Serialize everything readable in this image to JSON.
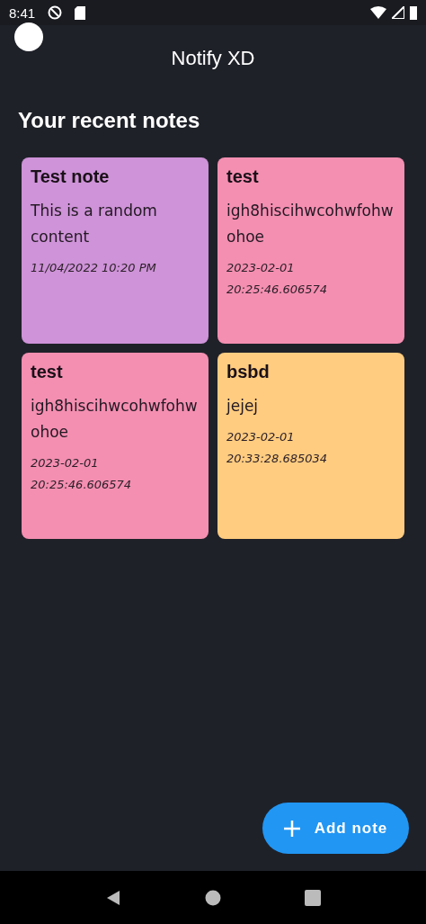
{
  "status_bar": {
    "time": "8:41"
  },
  "app_bar": {
    "title": "Notify XD"
  },
  "heading": "Your recent notes",
  "notes": [
    {
      "title": "Test note",
      "content": "This is a random content",
      "date": "11/04/2022 10:20 PM",
      "color": "#ce93d8"
    },
    {
      "title": "test",
      "content": "igh8hiscihwcohwfohwohoe",
      "date": "2023-02-01 20:25:46.606574",
      "color": "#f48fb1"
    },
    {
      "title": "test",
      "content": "igh8hiscihwcohwfohwohoe",
      "date": "2023-02-01 20:25:46.606574",
      "color": "#f48fb1"
    },
    {
      "title": "bsbd",
      "content": "jejej",
      "date": "2023-02-01 20:33:28.685034",
      "color": "#ffcc80"
    }
  ],
  "fab": {
    "label": "Add note"
  }
}
